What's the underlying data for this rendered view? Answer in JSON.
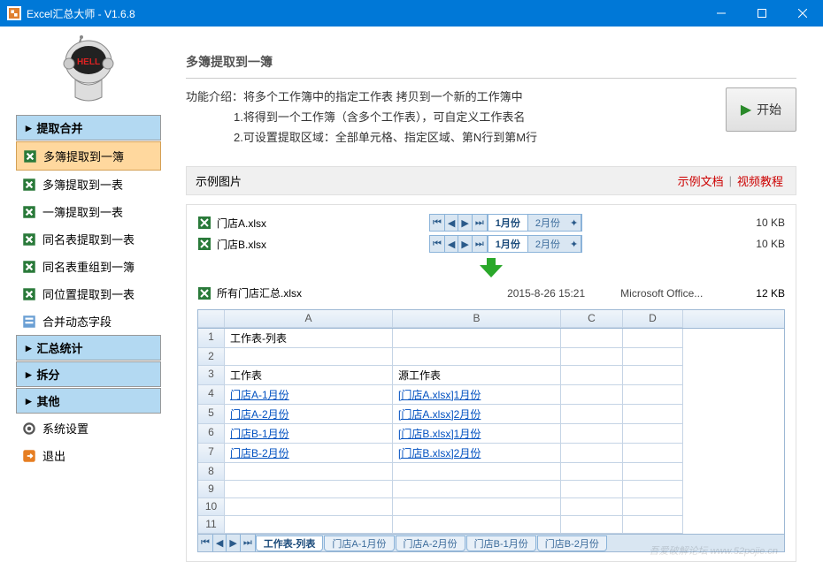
{
  "titlebar": {
    "title": "Excel汇总大师 - V1.6.8"
  },
  "sidebar": {
    "groups": [
      {
        "label": "提取合并",
        "items": [
          {
            "label": "多簿提取到一簿",
            "active": true
          },
          {
            "label": "多簿提取到一表"
          },
          {
            "label": "一簿提取到一表"
          },
          {
            "label": "同名表提取到一表"
          },
          {
            "label": "同名表重组到一簿"
          },
          {
            "label": "同位置提取到一表"
          },
          {
            "label": "合并动态字段"
          }
        ]
      },
      {
        "label": "汇总统计"
      },
      {
        "label": "拆分"
      },
      {
        "label": "其他"
      }
    ],
    "footer": [
      {
        "label": "系统设置"
      },
      {
        "label": "退出"
      }
    ]
  },
  "content": {
    "title": "多簿提取到一簿",
    "intro_label": "功能介绍：",
    "intro_main": "将多个工作簿中的指定工作表 拷贝到一个新的工作簿中",
    "intro_sub1": "1.将得到一个工作簿（含多个工作表），可自定义工作表名",
    "intro_sub2": "2.可设置提取区域：全部单元格、指定区域、第N行到第M行",
    "start_btn": "开始",
    "example_label": "示例图片",
    "example_doc": "示例文档",
    "example_video": "视频教程",
    "files": [
      {
        "name": "门店A.xlsx",
        "tabs": [
          "1月份",
          "2月份"
        ],
        "size": "10 KB"
      },
      {
        "name": "门店B.xlsx",
        "tabs": [
          "1月份",
          "2月份"
        ],
        "size": "10 KB"
      }
    ],
    "result": {
      "name": "所有门店汇总.xlsx",
      "date": "2015-8-26 15:21",
      "type": "Microsoft Office...",
      "size": "12 KB"
    },
    "grid": {
      "cols": [
        "A",
        "B",
        "C",
        "D"
      ],
      "rows": [
        {
          "n": "1",
          "a": "工作表-列表",
          "b": ""
        },
        {
          "n": "2",
          "a": "",
          "b": ""
        },
        {
          "n": "3",
          "a": "工作表",
          "b": "源工作表"
        },
        {
          "n": "4",
          "a": "门店A-1月份",
          "b": "[门店A.xlsx]1月份",
          "link": true
        },
        {
          "n": "5",
          "a": "门店A-2月份",
          "b": "[门店A.xlsx]2月份",
          "link": true
        },
        {
          "n": "6",
          "a": "门店B-1月份",
          "b": "[门店B.xlsx]1月份",
          "link": true
        },
        {
          "n": "7",
          "a": "门店B-2月份",
          "b": "[门店B.xlsx]2月份",
          "link": true
        },
        {
          "n": "8"
        },
        {
          "n": "9"
        },
        {
          "n": "10"
        },
        {
          "n": "11"
        }
      ],
      "tabs": [
        "工作表-列表",
        "门店A-1月份",
        "门店A-2月份",
        "门店B-1月份",
        "门店B-2月份"
      ]
    },
    "watermark": "吾爱破解论坛 www.52pojie.cn"
  }
}
